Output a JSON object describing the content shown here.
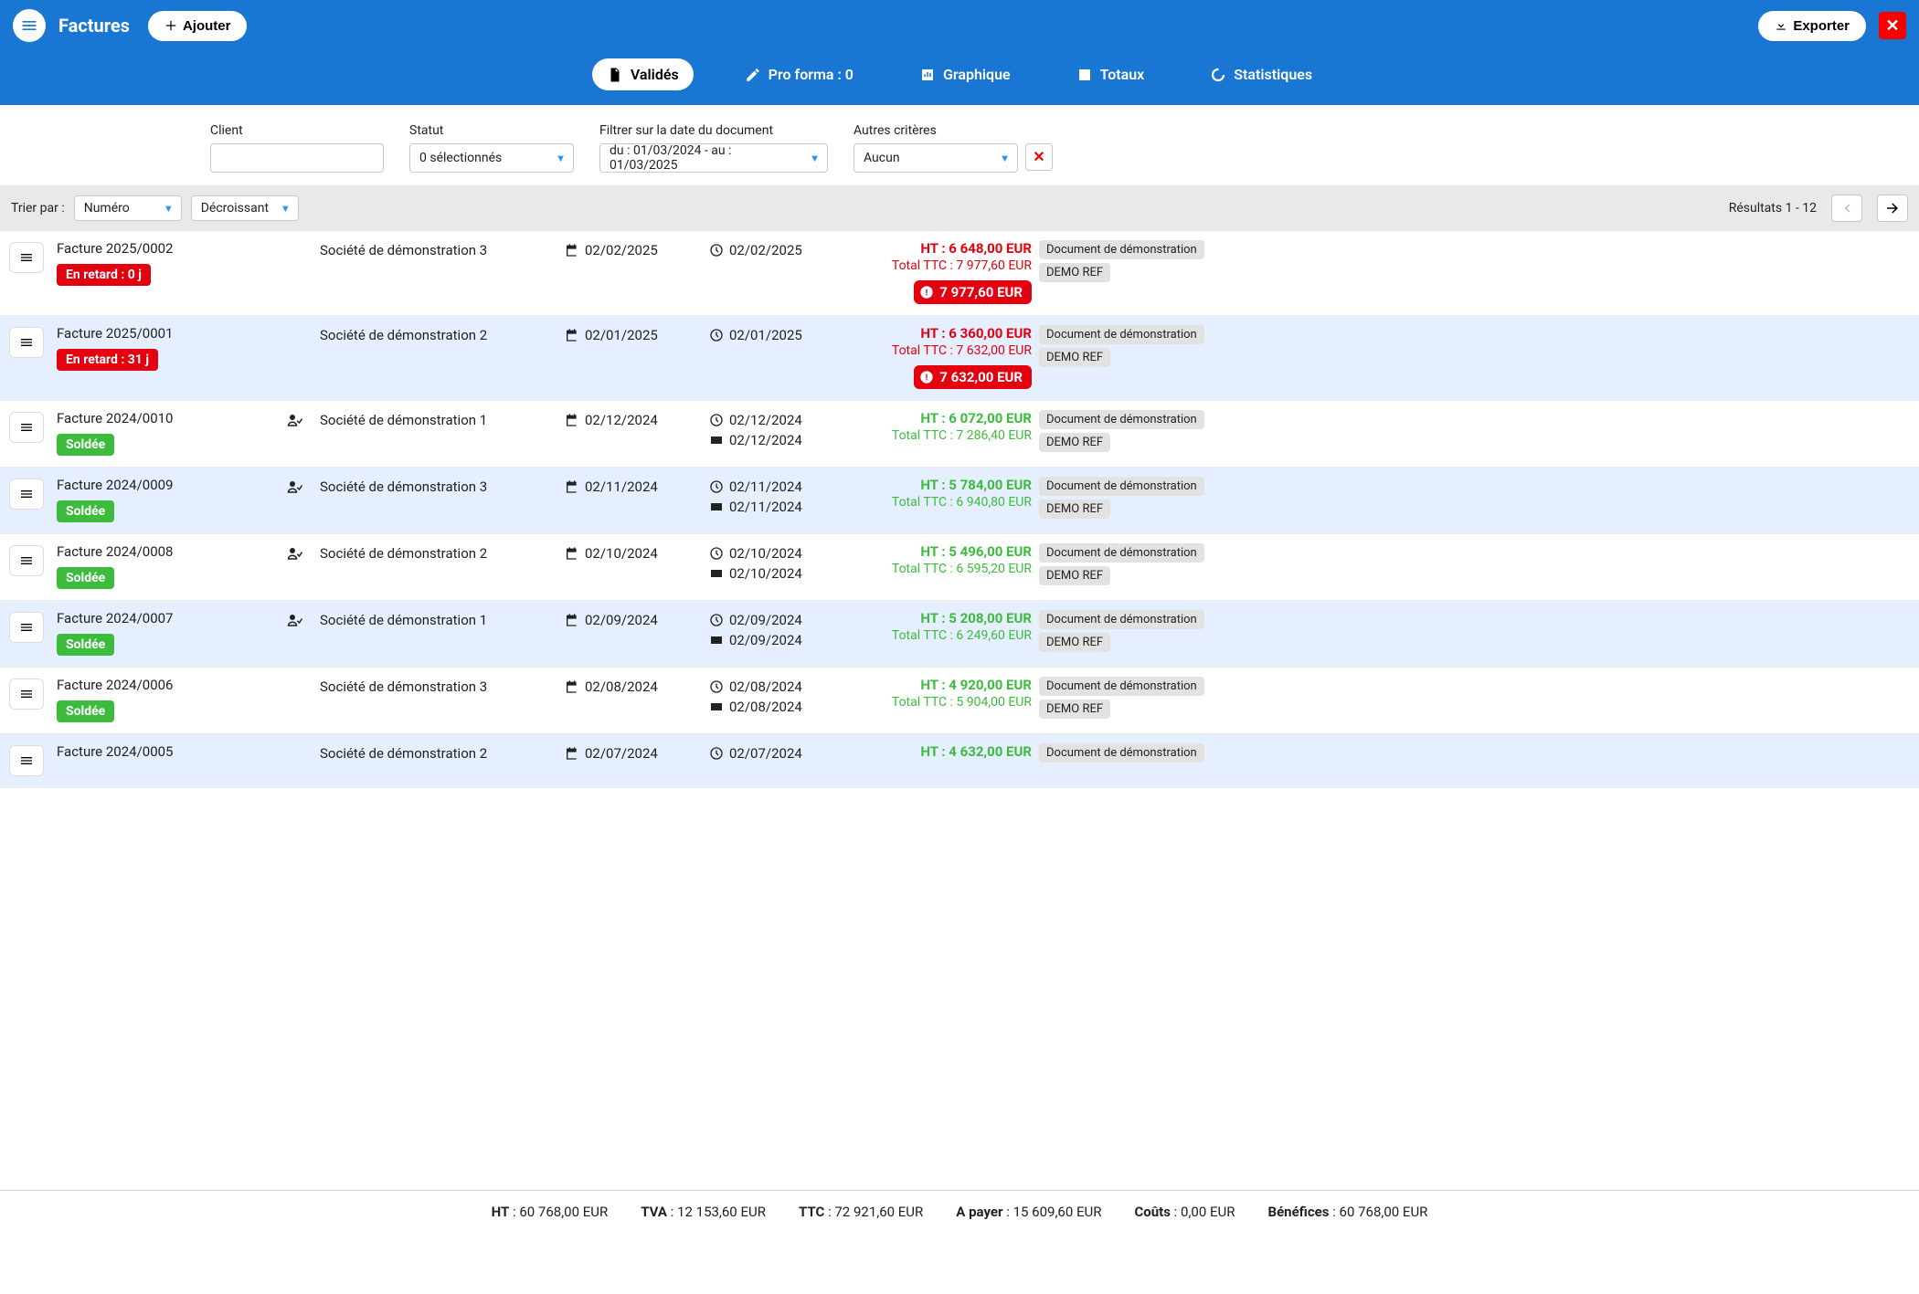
{
  "header": {
    "title": "Factures",
    "add_label": "Ajouter",
    "export_label": "Exporter"
  },
  "tabs": {
    "valides": "Validés",
    "proforma": "Pro forma : 0",
    "graphique": "Graphique",
    "totaux": "Totaux",
    "stats": "Statistiques"
  },
  "filters": {
    "client_label": "Client",
    "status_label": "Statut",
    "status_value": "0 sélectionnés",
    "date_label": "Filtrer sur la date du document",
    "date_value": "du : 01/03/2024 - au : 01/03/2025",
    "other_label": "Autres critères",
    "other_value": "Aucun"
  },
  "sortbar": {
    "label": "Trier par :",
    "field": "Numéro",
    "dir": "Décroissant",
    "results": "Résultats 1 - 12"
  },
  "rows": [
    {
      "name": "Facture 2025/0002",
      "company": "Société de démonstration 3",
      "date1": "02/02/2025",
      "due": "02/02/2025",
      "paid": null,
      "ht": "HT : 6 648,00 EUR",
      "ttc": "Total TTC : 7 977,60 EUR",
      "outstanding": "7 977,60 EUR",
      "status": "late",
      "status_text": "En retard : 0 j",
      "sig": false,
      "tag1": "Document de démonstration",
      "tag2": "DEMO REF",
      "amount_class": "red"
    },
    {
      "name": "Facture 2025/0001",
      "company": "Société de démonstration 2",
      "date1": "02/01/2025",
      "due": "02/01/2025",
      "paid": null,
      "ht": "HT : 6 360,00 EUR",
      "ttc": "Total TTC : 7 632,00 EUR",
      "outstanding": "7 632,00 EUR",
      "status": "late",
      "status_text": "En retard : 31 j",
      "sig": false,
      "tag1": "Document de démonstration",
      "tag2": "DEMO REF",
      "amount_class": "red"
    },
    {
      "name": "Facture 2024/0010",
      "company": "Société de démonstration 1",
      "date1": "02/12/2024",
      "due": "02/12/2024",
      "paid": "02/12/2024",
      "ht": "HT : 6 072,00 EUR",
      "ttc": "Total TTC : 7 286,40 EUR",
      "outstanding": null,
      "status": "paid",
      "status_text": "Soldée",
      "sig": true,
      "tag1": "Document de démonstration",
      "tag2": "DEMO REF",
      "amount_class": "green"
    },
    {
      "name": "Facture 2024/0009",
      "company": "Société de démonstration 3",
      "date1": "02/11/2024",
      "due": "02/11/2024",
      "paid": "02/11/2024",
      "ht": "HT : 5 784,00 EUR",
      "ttc": "Total TTC : 6 940,80 EUR",
      "outstanding": null,
      "status": "paid",
      "status_text": "Soldée",
      "sig": true,
      "tag1": "Document de démonstration",
      "tag2": "DEMO REF",
      "amount_class": "green"
    },
    {
      "name": "Facture 2024/0008",
      "company": "Société de démonstration 2",
      "date1": "02/10/2024",
      "due": "02/10/2024",
      "paid": "02/10/2024",
      "ht": "HT : 5 496,00 EUR",
      "ttc": "Total TTC : 6 595,20 EUR",
      "outstanding": null,
      "status": "paid",
      "status_text": "Soldée",
      "sig": true,
      "tag1": "Document de démonstration",
      "tag2": "DEMO REF",
      "amount_class": "green"
    },
    {
      "name": "Facture 2024/0007",
      "company": "Société de démonstration 1",
      "date1": "02/09/2024",
      "due": "02/09/2024",
      "paid": "02/09/2024",
      "ht": "HT : 5 208,00 EUR",
      "ttc": "Total TTC : 6 249,60 EUR",
      "outstanding": null,
      "status": "paid",
      "status_text": "Soldée",
      "sig": true,
      "tag1": "Document de démonstration",
      "tag2": "DEMO REF",
      "amount_class": "green"
    },
    {
      "name": "Facture 2024/0006",
      "company": "Société de démonstration 3",
      "date1": "02/08/2024",
      "due": "02/08/2024",
      "paid": "02/08/2024",
      "ht": "HT : 4 920,00 EUR",
      "ttc": "Total TTC : 5 904,00 EUR",
      "outstanding": null,
      "status": "paid",
      "status_text": "Soldée",
      "sig": false,
      "tag1": "Document de démonstration",
      "tag2": "DEMO REF",
      "amount_class": "green"
    },
    {
      "name": "Facture 2024/0005",
      "company": "Société de démonstration 2",
      "date1": "02/07/2024",
      "due": "02/07/2024",
      "paid": null,
      "ht": "HT : 4 632,00 EUR",
      "ttc": "",
      "outstanding": null,
      "status": null,
      "status_text": "",
      "sig": false,
      "tag1": "Document de démonstration",
      "tag2": "",
      "amount_class": "green"
    }
  ],
  "footer": {
    "ht_label": "HT",
    "ht_val": " : 60 768,00 EUR",
    "tva_label": "TVA",
    "tva_val": " : 12 153,60 EUR",
    "ttc_label": "TTC",
    "ttc_val": " : 72 921,60 EUR",
    "pay_label": "A payer",
    "pay_val": " : 15 609,60 EUR",
    "couts_label": "Coûts",
    "couts_val": " : 0,00 EUR",
    "benef_label": "Bénéfices",
    "benef_val": " : 60 768,00 EUR"
  }
}
